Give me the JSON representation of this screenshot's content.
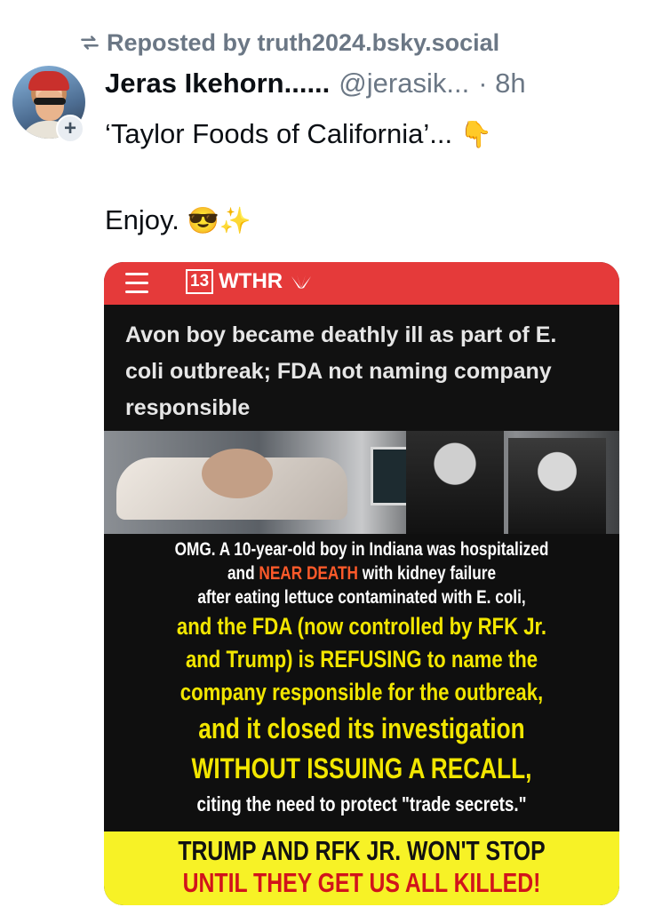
{
  "repost": {
    "label": "Reposted by truth2024.bsky.social",
    "icon": "repost-icon"
  },
  "post": {
    "author_name": "Jeras Ikehorn......",
    "handle": "@jerasik...",
    "time": "· 8h",
    "line1": "‘Taylor Foods of California’...",
    "line1_emoji": "👇",
    "line2": "Enjoy.",
    "line2_emoji": "😎✨",
    "follow_badge": "+"
  },
  "media": {
    "station_number": "13",
    "station_name": "WTHR",
    "headline": "Avon boy became deathly ill as part of E. coli outbreak; FDA not naming company responsible",
    "caption": {
      "l1": "OMG. A 10-year-old boy in Indiana was hospitalized",
      "l2_a": "and ",
      "l2_b": "NEAR DEATH",
      "l2_c": " with kidney failure",
      "l3": "after eating lettuce contaminated with E. coli,",
      "l4": "and the FDA (now controlled by RFK Jr.",
      "l5": "and Trump) is REFUSING to name the",
      "l6": "company responsible for the outbreak,",
      "l7": "and it closed its investigation",
      "l8": "WITHOUT ISSUING A RECALL,",
      "l9": "citing the need to protect \"trade secrets.\""
    },
    "footer": {
      "l1": "TRUMP AND RFK JR. WON'T STOP",
      "l2": "UNTIL THEY GET US ALL KILLED!"
    }
  },
  "colors": {
    "text": "#0b0f14",
    "muted": "#6b7785",
    "wthr_red": "#e53a3a",
    "caption_yellow": "#f2e600",
    "footer_yellow": "#f7f226",
    "footer_red": "#d1141b"
  }
}
